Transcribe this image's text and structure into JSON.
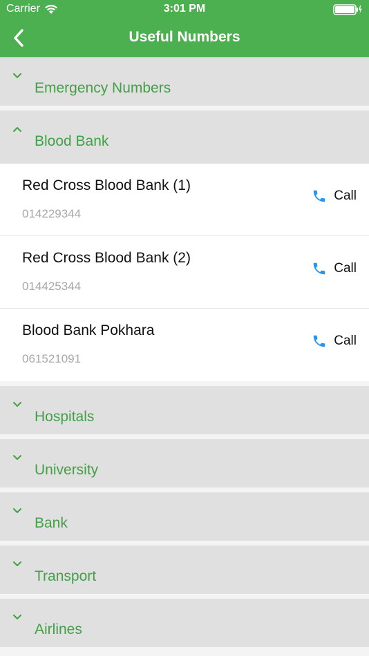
{
  "status": {
    "carrier": "Carrier",
    "time": "3:01 PM"
  },
  "nav": {
    "title": "Useful Numbers"
  },
  "colors": {
    "accent": "#4caf50",
    "section_text": "#43a047",
    "call_icon": "#2196f3"
  },
  "sections": [
    {
      "label": "Emergency Numbers",
      "expanded": false
    },
    {
      "label": "Blood Bank",
      "expanded": true,
      "items": [
        {
          "name": "Red Cross Blood Bank (1)",
          "number": "014229344",
          "action": "Call"
        },
        {
          "name": "Red Cross Blood Bank (2)",
          "number": "014425344",
          "action": "Call"
        },
        {
          "name": "Blood Bank Pokhara",
          "number": "061521091",
          "action": "Call"
        }
      ]
    },
    {
      "label": "Hospitals",
      "expanded": false
    },
    {
      "label": "University",
      "expanded": false
    },
    {
      "label": "Bank",
      "expanded": false
    },
    {
      "label": "Transport",
      "expanded": false
    },
    {
      "label": "Airlines",
      "expanded": false
    }
  ]
}
